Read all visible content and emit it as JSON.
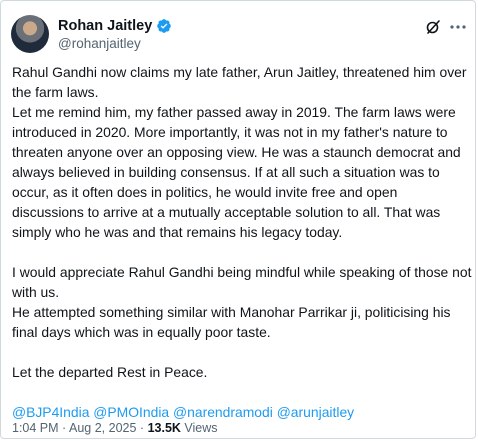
{
  "author": {
    "display_name": "Rohan Jaitley",
    "handle": "@rohanjaitley",
    "verified_color": "#1d9bf0"
  },
  "icons": {
    "avatar": "profile-photo",
    "verified": "verified-badge-icon",
    "grok": "grok-icon",
    "more": "more-options-icon"
  },
  "tweet": {
    "paragraphs": [
      "Rahul Gandhi now claims my late father, Arun Jaitley, threatened him over the farm laws.",
      "Let me remind him, my father passed away in 2019. The farm laws were introduced in 2020. More importantly, it was not in my father's nature to threaten anyone over an opposing view. He was a staunch democrat and always believed in building consensus. If at all such a situation was to occur, as it often does in politics, he would invite free and open discussions to arrive at a mutually acceptable solution to all. That was simply who he was and that remains his legacy today.",
      "I would appreciate Rahul Gandhi being mindful while speaking of those not with us.",
      "He attempted something similar with Manohar Parrikar ji, politicising his final days which was in equally poor taste.",
      "Let the departed Rest in Peace."
    ],
    "mentions": [
      "@BJP4India",
      "@PMOIndia",
      "@narendramodi",
      "@arunjaitley"
    ]
  },
  "meta": {
    "time": "1:04 PM",
    "separator": "·",
    "date": "Aug 2, 2025",
    "views_count": "13.5K",
    "views_label": "Views"
  },
  "colors": {
    "link": "#1d9bf0",
    "text": "#0f1419",
    "secondary": "#536471",
    "border": "#cfd9de"
  }
}
